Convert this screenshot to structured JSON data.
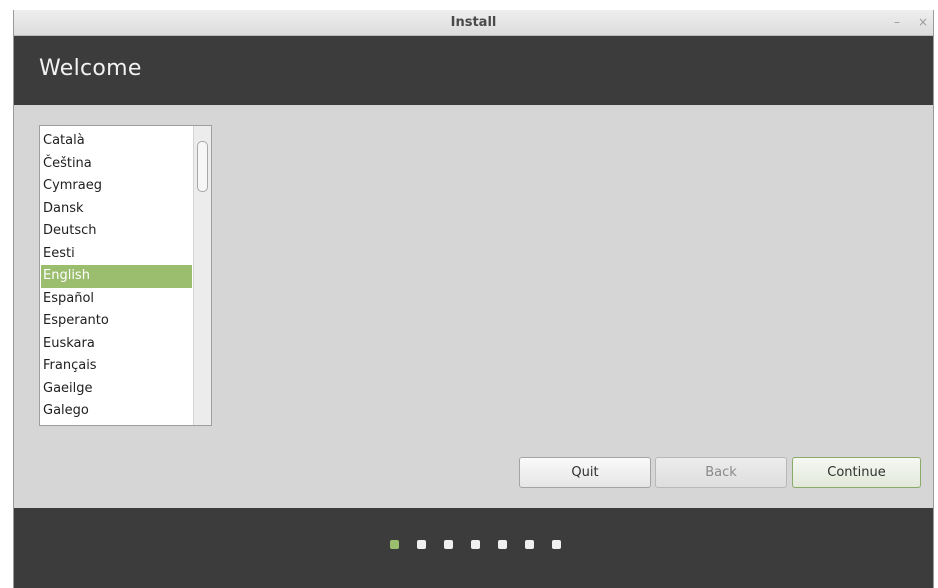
{
  "window": {
    "title": "Install",
    "minimize_glyph": "–",
    "close_glyph": "×"
  },
  "header": {
    "title": "Welcome"
  },
  "language_list": {
    "selected": "English",
    "items": [
      "Català",
      "Čeština",
      "Cymraeg",
      "Dansk",
      "Deutsch",
      "Eesti",
      "English",
      "Español",
      "Esperanto",
      "Euskara",
      "Français",
      "Gaeilge",
      "Galego"
    ]
  },
  "buttons": {
    "quit": "Quit",
    "back": "Back",
    "continue": "Continue"
  },
  "progress": {
    "current_step": 1,
    "total_steps": 7
  },
  "colors": {
    "accent": "#9bbd6e",
    "header_bg": "#3c3c3c",
    "body_bg": "#d6d6d6"
  }
}
